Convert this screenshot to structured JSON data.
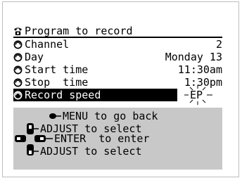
{
  "menu": {
    "title": "Program to record",
    "items": [
      {
        "label": "Channel",
        "value": "2"
      },
      {
        "label": "Day",
        "value": "Monday 13"
      },
      {
        "label": "Start time",
        "value": "11:30am"
      },
      {
        "label": "Stop  time",
        "value": "1:30pm"
      },
      {
        "label": "Record speed",
        "value": "EP"
      }
    ]
  },
  "help": {
    "menu_line": "MENU to go back",
    "adjust_line_1": "ADJUST to select",
    "enter_line": "ENTER  to enter",
    "adjust_line_2": "ADJUST to select"
  },
  "icons": {
    "title": "phone-icon",
    "item": "disc-icon"
  }
}
